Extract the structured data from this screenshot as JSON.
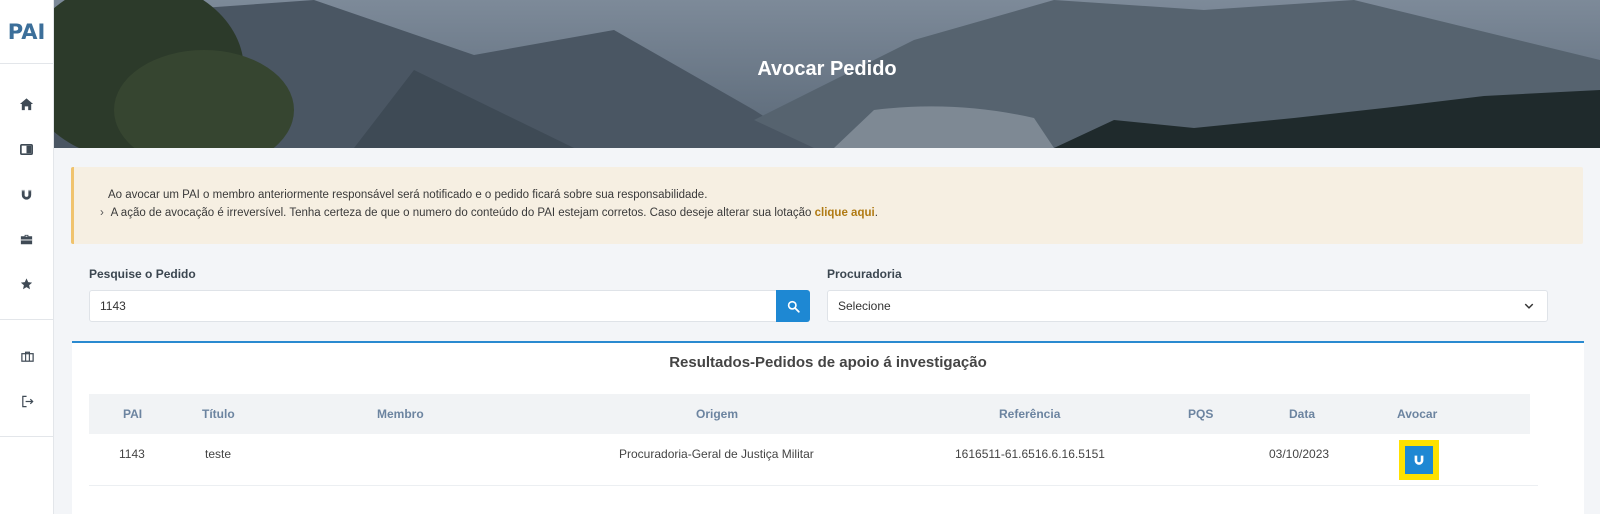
{
  "app": {
    "logo": "PAI"
  },
  "sidebar": {
    "items": [
      {
        "icon": "home-icon"
      },
      {
        "icon": "book-icon"
      },
      {
        "icon": "magnet-icon"
      },
      {
        "icon": "briefcase-icon"
      },
      {
        "icon": "star-hand-icon"
      },
      {
        "icon": "briefcase-outline-icon"
      },
      {
        "icon": "logout-icon"
      }
    ]
  },
  "hero": {
    "title": "Avocar Pedido"
  },
  "alert": {
    "line1": "Ao avocar um PAI o membro anteriormente responsável será notificado e o pedido ficará sobre sua responsabilidade.",
    "line2_chevron": "›",
    "line2": "A ação de avocação é irreversível. Tenha certeza de que o numero do conteúdo do PAI estejam corretos. Caso deseje alterar sua lotação ",
    "link": "clique aqui",
    "line2_end": "."
  },
  "search": {
    "label": "Pesquise o Pedido",
    "value": "1143"
  },
  "procuradoria": {
    "label": "Procuradoria",
    "selected": "Selecione"
  },
  "results": {
    "title": "Resultados-Pedidos de apoio á investigação",
    "columns": [
      "PAI",
      "Título",
      "Membro",
      "Origem",
      "Referência",
      "PQS",
      "Data",
      "Avocar"
    ],
    "rows": [
      {
        "pai": "1143",
        "titulo": "teste",
        "membro": "",
        "origem": "Procuradoria-Geral de Justiça Militar",
        "referencia": "1616511-61.6516.6.16.5151",
        "pqs": "",
        "data": "03/10/2023"
      }
    ]
  },
  "colors": {
    "accent": "#1e88d3",
    "highlight": "#ffe100",
    "alert_bg": "#f6efe2",
    "alert_border": "#f0c36d",
    "link": "#b07a13"
  }
}
